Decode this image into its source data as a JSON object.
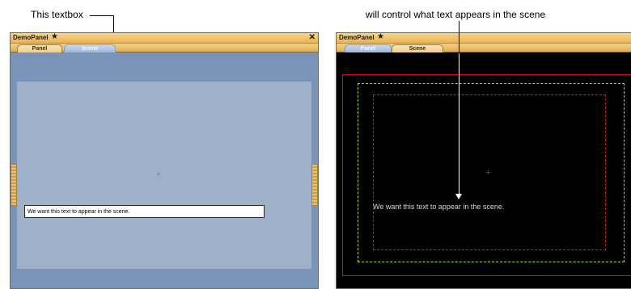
{
  "annotations": {
    "left_caption": "This textbox",
    "right_caption": "will control what text appears in the scene"
  },
  "left_panel": {
    "title": "DemoPanel",
    "tabs": [
      {
        "label": "Panel",
        "active": true
      },
      {
        "label": "Scene",
        "active": false
      }
    ],
    "textbox_value": "We want this text to appear in the scene."
  },
  "right_panel": {
    "title": "DemoPanel",
    "tabs": [
      {
        "label": "Panel",
        "active": false
      },
      {
        "label": "Scene",
        "active": true
      }
    ],
    "scene_text": "We want this text to appear in the scene."
  },
  "colors": {
    "titlebar": "#e8b356",
    "panel_bg": "#9fb1c8",
    "scene_bg": "#000000",
    "safe_frame_red": "#cc1a1a",
    "title_safe_yellow": "#c8c820"
  },
  "icons": {
    "pin": "pin-icon",
    "close": "close-icon",
    "crosshair": "crosshair-icon"
  }
}
